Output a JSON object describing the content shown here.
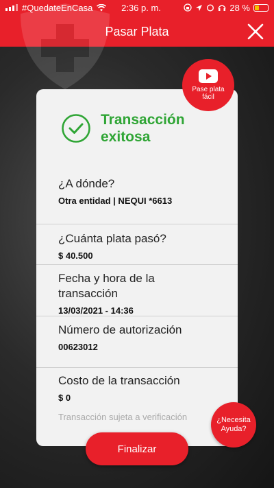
{
  "status_bar": {
    "hashtag": "#QuedateEnCasa",
    "time": "2:36 p. m.",
    "battery": "28 %",
    "battery_color": "#f2c200"
  },
  "header": {
    "title": "Pasar Plata",
    "close_icon": "close-icon",
    "brand_color": "#e8202a"
  },
  "video_badge": {
    "icon": "youtube-play-icon",
    "label": "Pase plata fácil"
  },
  "result": {
    "icon": "check-circle-icon",
    "title": "Transacción exitosa",
    "color": "#2fa535"
  },
  "details": [
    {
      "label": "¿A dónde?",
      "value": "Otra entidad | NEQUI *6613"
    },
    {
      "label": "¿Cuánta plata pasó?",
      "value": "$ 40.500"
    },
    {
      "label": "Fecha y hora de la transacción",
      "value": "13/03/2021 - 14:36"
    },
    {
      "label": "Número de autorización",
      "value": "00623012"
    },
    {
      "label": "Costo de la transacción",
      "value": "$ 0"
    }
  ],
  "note": "Transacción sujeta a verificación",
  "help_badge": {
    "label": "¿Necesita Ayuda?"
  },
  "actions": {
    "finalize_label": "Finalizar"
  }
}
